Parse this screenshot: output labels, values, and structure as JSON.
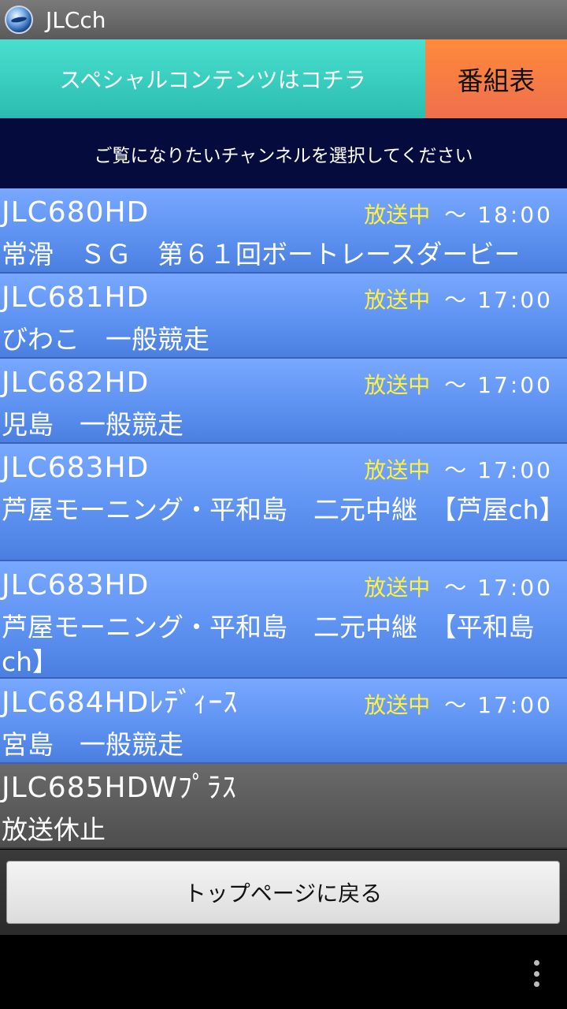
{
  "app": {
    "title": "JLCch",
    "icon": "jlc-logo-icon"
  },
  "banner": {
    "special_label": "スペシャルコンテンツはコチラ",
    "schedule_label": "番組表"
  },
  "instruction": "ご覧になりたいチャンネルを選択してください",
  "colors": {
    "onair": "#fff23a",
    "row_blue": "#6a9cf8",
    "row_off": "#5a5a5a",
    "special": "#3cd2c2",
    "schedule": "#f87a45",
    "instruction_bg": "#060b3d"
  },
  "channels": [
    {
      "name": "JLC680HD",
      "status": "放送中",
      "tilde": "～",
      "time": "18:00",
      "program": "常滑　ＳＧ　第６１回ボートレースダービー"
    },
    {
      "name": "JLC681HD",
      "status": "放送中",
      "tilde": "～",
      "time": "17:00",
      "program": "びわこ　一般競走"
    },
    {
      "name": "JLC682HD",
      "status": "放送中",
      "tilde": "～",
      "time": "17:00",
      "program": "児島　一般競走"
    },
    {
      "name": "JLC683HD",
      "status": "放送中",
      "tilde": "～",
      "time": "17:00",
      "program": "芦屋モーニング・平和島　二元中継　【芦屋ch】"
    },
    {
      "name": "JLC683HD",
      "status": "放送中",
      "tilde": "～",
      "time": "17:00",
      "program": "芦屋モーニング・平和島　二元中継　【平和島ch】"
    },
    {
      "name": "JLC684HDﾚﾃﾞｨｰｽ",
      "status": "放送中",
      "tilde": "～",
      "time": "17:00",
      "program": "宮島　一般競走"
    },
    {
      "name": "JLC685HDWﾌﾟﾗｽ",
      "status": "",
      "tilde": "",
      "time": "",
      "program": "放送休止"
    }
  ],
  "bottom": {
    "top_page_label": "トップページに戻る"
  },
  "navbar": {
    "overflow_icon": "overflow-menu-icon"
  }
}
